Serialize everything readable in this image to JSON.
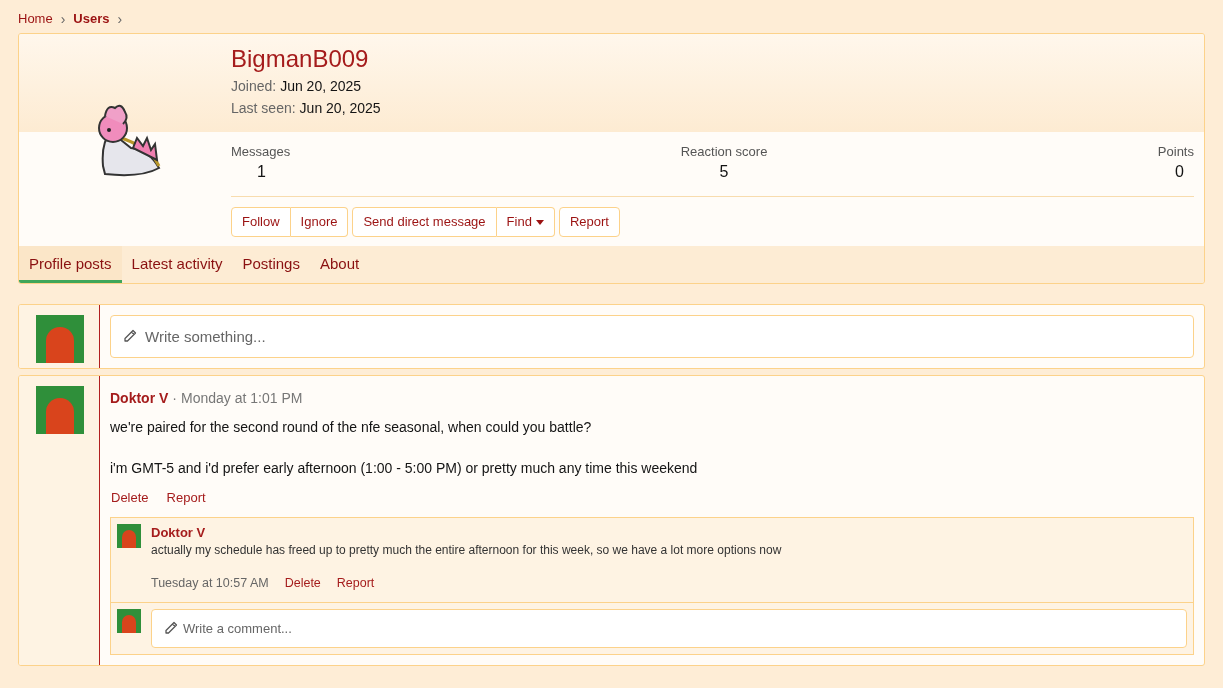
{
  "breadcrumb": [
    {
      "label": "Home",
      "selected": false,
      "separator": "›"
    },
    {
      "label": "Users",
      "selected": true,
      "separator": "›"
    }
  ],
  "profile": {
    "username": "BigmanB009",
    "fields": [
      {
        "label": "Joined:",
        "value": "Jun 20, 2025"
      },
      {
        "label": "Last seen:",
        "value": "Jun 20, 2025"
      }
    ],
    "stats": [
      {
        "label": "Messages",
        "value": "1"
      },
      {
        "label": "Reaction score",
        "value": "5"
      },
      {
        "label": "Points",
        "value": "0"
      }
    ],
    "button_groups": [
      [
        {
          "label": "Follow",
          "kind": "plain"
        },
        {
          "label": "Ignore",
          "kind": "plain"
        }
      ],
      [
        {
          "label": "Send direct message",
          "kind": "plain"
        },
        {
          "label": "Find",
          "kind": "dropdown"
        }
      ],
      [
        {
          "label": "Report",
          "kind": "plain"
        }
      ]
    ]
  },
  "tabs": [
    {
      "label": "Profile posts",
      "selected": true
    },
    {
      "label": "Latest activity",
      "selected": false
    },
    {
      "label": "Postings",
      "selected": false
    },
    {
      "label": "About",
      "selected": false
    }
  ],
  "composer": {
    "placeholder": "Write something..."
  },
  "posts": [
    {
      "author": "Doktor V",
      "separator": "·",
      "time": "Monday at 1:01 PM",
      "paragraphs": [
        "we're paired for the second round of the nfe seasonal, when could you battle?",
        "i'm GMT-5 and i'd prefer early afternoon (1:00 - 5:00 PM) or pretty much any time this weekend"
      ],
      "actions": [
        "Delete",
        "Report"
      ],
      "comments": [
        {
          "author": "Doktor V",
          "text": "actually my schedule has freed up to pretty much the entire afternoon for this week, so we have a lot more options now",
          "time": "Tuesday at 10:57 AM",
          "actions": [
            "Delete",
            "Report"
          ]
        }
      ],
      "comment_placeholder": "Write a comment..."
    }
  ]
}
